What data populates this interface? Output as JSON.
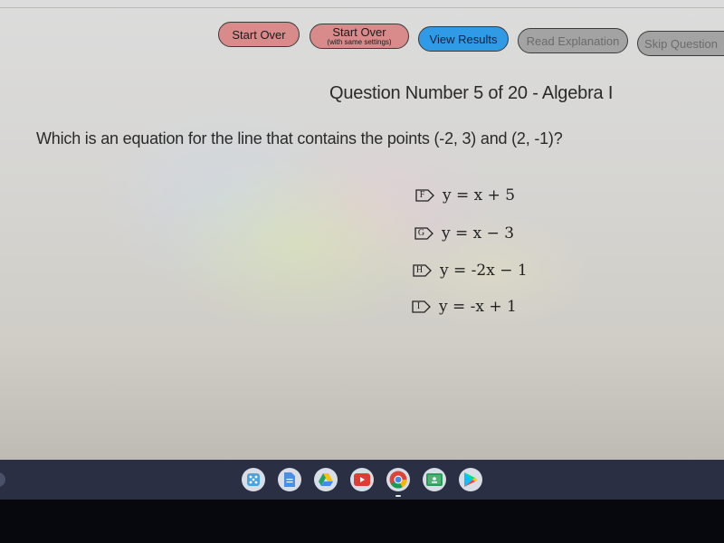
{
  "toolbar": {
    "start_over": "Start Over",
    "start_over_same": "Start Over",
    "start_over_same_sub": "(with same settings)",
    "view_results": "View Results",
    "read_explanation": "Read Explanation",
    "skip_question": "Skip Question"
  },
  "question": {
    "header": "Question Number 5 of 20 - Algebra I",
    "text": "Which is an equation for the line that contains the points (-2, 3) and (2, -1)?",
    "choices": [
      {
        "letter": "F",
        "equation": "y = x + 5"
      },
      {
        "letter": "G",
        "equation": "y = x − 3"
      },
      {
        "letter": "H",
        "equation": "y = -2x − 1"
      },
      {
        "letter": "I",
        "equation": "y = -x + 1"
      }
    ]
  },
  "colors": {
    "red_button": "#d98b8b",
    "blue_button": "#2f9be6",
    "gray_button": "#a3a3a3",
    "shelf": "#2a2f44"
  },
  "shelf": {
    "apps": [
      {
        "name": "launcher-app-icon",
        "icon": "grid"
      },
      {
        "name": "docs-app-icon",
        "icon": "document"
      },
      {
        "name": "drive-app-icon",
        "icon": "triangle"
      },
      {
        "name": "youtube-app-icon",
        "icon": "play"
      },
      {
        "name": "chrome-app-icon",
        "icon": "chrome"
      },
      {
        "name": "classroom-app-icon",
        "icon": "classroom"
      },
      {
        "name": "play-store-app-icon",
        "icon": "play-triangle"
      }
    ]
  }
}
